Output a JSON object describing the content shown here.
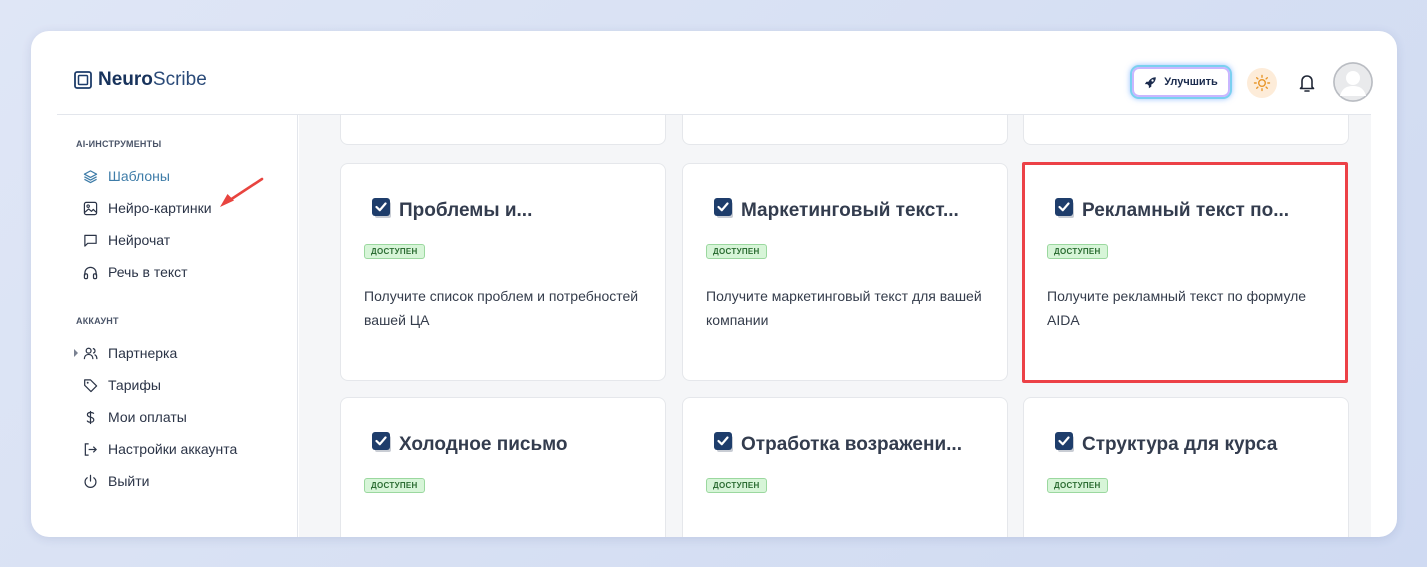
{
  "app": {
    "brand_bold": "Neuro",
    "brand_light": "Scribe"
  },
  "header": {
    "upgrade_label": "Улучшить"
  },
  "sidebar": {
    "section_tools": "AI-ИНСТРУМЕНТЫ",
    "tools": [
      {
        "label": "Шаблоны",
        "icon": "layers-icon",
        "active": true
      },
      {
        "label": "Нейро-картинки",
        "icon": "image-icon"
      },
      {
        "label": "Нейрочат",
        "icon": "chat-icon"
      },
      {
        "label": "Речь в текст",
        "icon": "headphones-icon"
      }
    ],
    "section_account": "АККАУНТ",
    "account": [
      {
        "label": "Партнерка",
        "icon": "users-icon"
      },
      {
        "label": "Тарифы",
        "icon": "tag-icon"
      },
      {
        "label": "Мои оплаты",
        "icon": "dollar-icon"
      },
      {
        "label": "Настройки аккаунта",
        "icon": "logout-arrow-icon"
      },
      {
        "label": "Выйти",
        "icon": "power-icon"
      }
    ]
  },
  "cards": [
    {
      "title": "Проблемы и...",
      "badge": "ДОСТУПЕН",
      "description": "Получите список проблем и потребностей вашей ЦА"
    },
    {
      "title": "Маркетинговый текст...",
      "badge": "ДОСТУПЕН",
      "description": "Получите маркетинговый текст для вашей компании"
    },
    {
      "title": "Рекламный текст по...",
      "badge": "ДОСТУПЕН",
      "description": "Получите рекламный текст по формуле AIDA",
      "highlighted": true
    },
    {
      "title": "Холодное письмо",
      "badge": "ДОСТУПЕН",
      "description": ""
    },
    {
      "title": "Отработка возражени...",
      "badge": "ДОСТУПЕН",
      "description": ""
    },
    {
      "title": "Структура для курса",
      "badge": "ДОСТУПЕН",
      "description": ""
    }
  ],
  "colors": {
    "accent": "#3e7ca8",
    "highlight": "#ec4147",
    "badge_bg": "#d7f5d8",
    "badge_text": "#2c6d33",
    "check_icon": "#1e3d6b"
  }
}
